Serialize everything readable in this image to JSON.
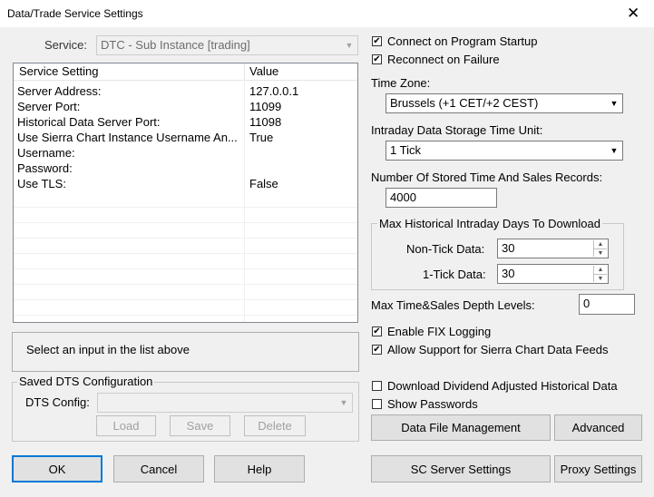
{
  "window": {
    "title": "Data/Trade Service Settings",
    "close_glyph": "✕"
  },
  "service": {
    "label": "Service:",
    "value": "DTC - Sub Instance   [trading]"
  },
  "settings_list": {
    "headers": [
      "Service Setting",
      "Value"
    ],
    "rows": [
      {
        "setting": "Server Address:",
        "value": "127.0.0.1"
      },
      {
        "setting": "Server Port:",
        "value": "11099"
      },
      {
        "setting": "Historical Data Server Port:",
        "value": "11098"
      },
      {
        "setting": "Use Sierra Chart Instance Username An...",
        "value": "True"
      },
      {
        "setting": "Username:",
        "value": ""
      },
      {
        "setting": "Password:",
        "value": ""
      },
      {
        "setting": "Use TLS:",
        "value": "False"
      }
    ]
  },
  "input_hint": "Select an input in the list above",
  "saved_dts": {
    "legend": "Saved DTS Configuration",
    "config_label": "DTS Config:",
    "config_value": "",
    "load": "Load",
    "save": "Save",
    "delete": "Delete"
  },
  "right": {
    "connect_startup": {
      "label": "Connect on Program Startup",
      "checked": true
    },
    "reconnect_failure": {
      "label": "Reconnect on Failure",
      "checked": true
    },
    "timezone": {
      "label": "Time Zone:",
      "value": "Brussels (+1 CET/+2 CEST)"
    },
    "storage_unit": {
      "label": "Intraday Data Storage Time Unit:",
      "value": "1 Tick"
    },
    "stored_records": {
      "label": "Number Of Stored Time And Sales Records:",
      "value": "4000"
    },
    "max_hist": {
      "legend": "Max Historical Intraday Days To Download",
      "non_tick_label": "Non-Tick Data:",
      "non_tick_value": "30",
      "one_tick_label": "1-Tick Data:",
      "one_tick_value": "30"
    },
    "depth_levels": {
      "label": "Max Time&Sales Depth Levels:",
      "value": "0"
    },
    "fix_logging": {
      "label": "Enable FIX Logging",
      "checked": true
    },
    "sc_data_feeds": {
      "label": "Allow Support for Sierra Chart Data Feeds",
      "checked": true
    },
    "dividend_adjusted": {
      "label": "Download Dividend Adjusted Historical Data",
      "checked": false
    },
    "show_passwords": {
      "label": "Show Passwords",
      "checked": false
    }
  },
  "buttons": {
    "data_file_management": "Data File Management",
    "advanced": "Advanced",
    "ok": "OK",
    "cancel": "Cancel",
    "help": "Help",
    "sc_server_settings": "SC Server Settings",
    "proxy_settings": "Proxy Settings"
  },
  "glyphs": {
    "check": "✔",
    "dropdown": "▼",
    "spin_up": "▲",
    "spin_down": "▼"
  }
}
